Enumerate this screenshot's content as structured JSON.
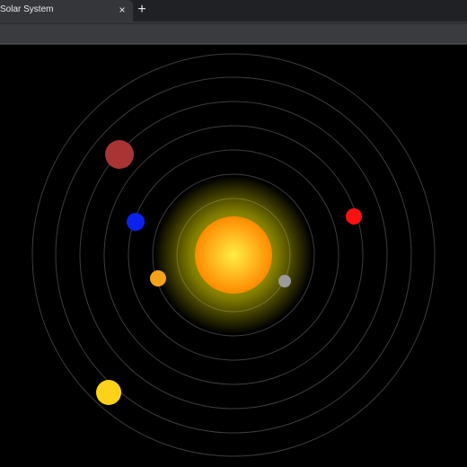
{
  "browser": {
    "tab": {
      "title": "Solar System",
      "close_glyph": "×"
    },
    "new_tab_glyph": "+",
    "address_bar": {
      "value": ""
    }
  },
  "scene": {
    "background": "#000000",
    "orbit_color": "#3c3c3c",
    "sun": {
      "name": "sun",
      "color_core": "#ffee44",
      "color_edge": "#ff8a00",
      "glow_color": "#e8e000"
    },
    "planets": [
      {
        "name": "planet-grey",
        "color": "#9a9a9a"
      },
      {
        "name": "planet-orange",
        "color": "#f4a21a"
      },
      {
        "name": "planet-blue",
        "color": "#0b22ee"
      },
      {
        "name": "planet-red",
        "color": "#ff1010"
      },
      {
        "name": "planet-maroon",
        "color": "#a83434"
      },
      {
        "name": "planet-yellow",
        "color": "#ffd21a"
      }
    ]
  }
}
